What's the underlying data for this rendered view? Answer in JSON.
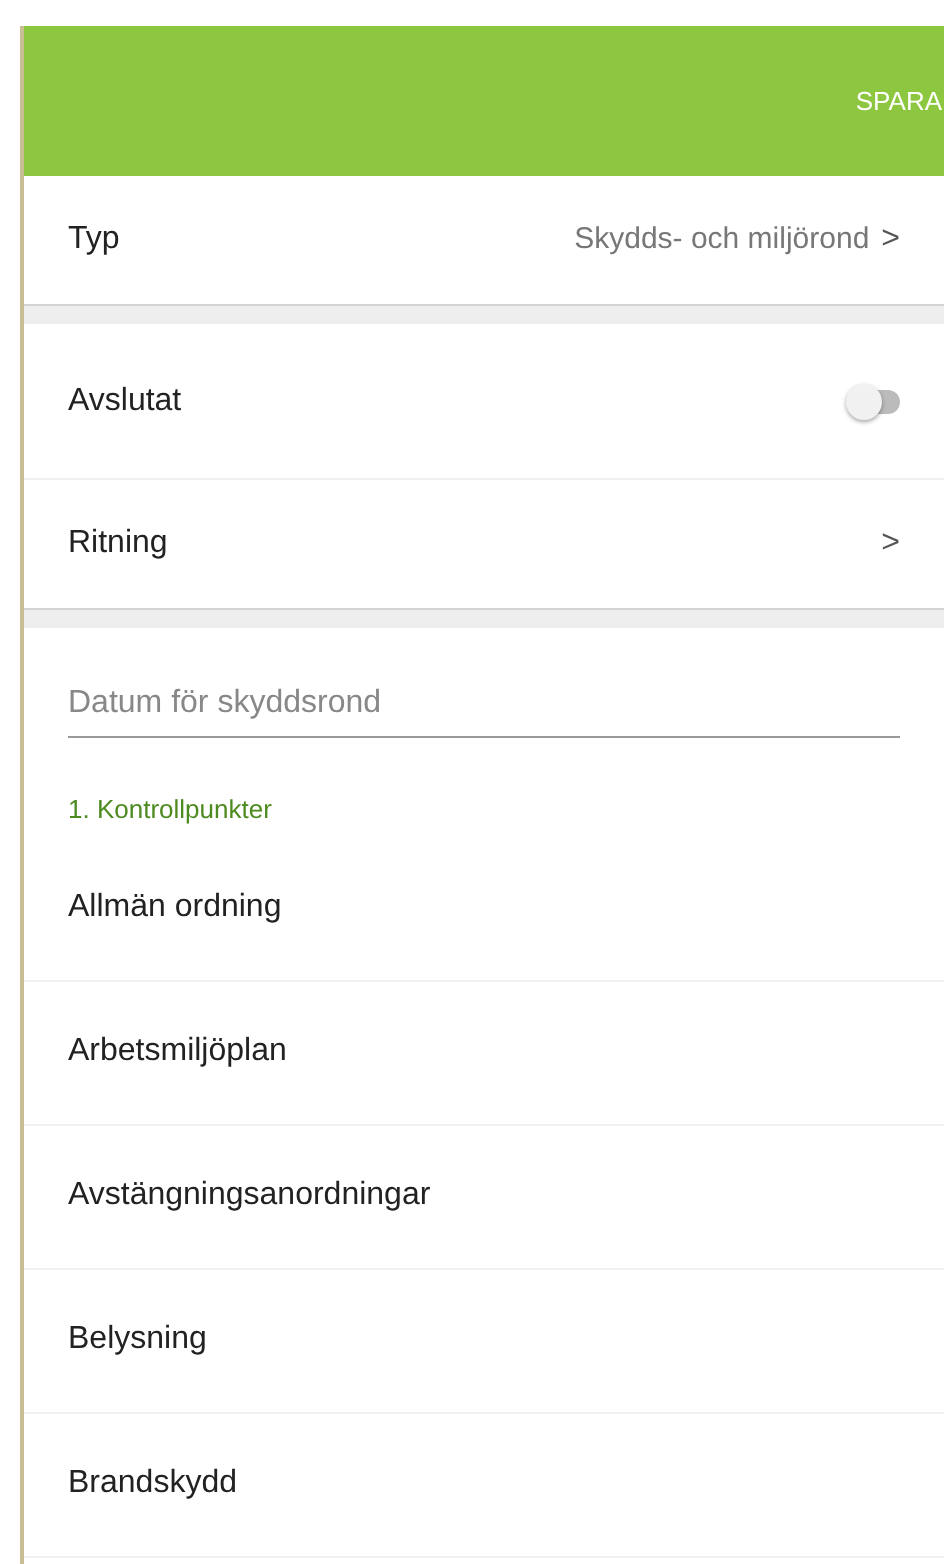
{
  "header": {
    "action": "SPARA"
  },
  "type_row": {
    "label": "Typ",
    "value": "Skydds- och miljörond",
    "chevron": ">"
  },
  "settings": [
    {
      "kind": "toggle",
      "label": "Avslutat",
      "on": false
    },
    {
      "kind": "link",
      "label": "Ritning",
      "chevron": ">"
    }
  ],
  "date_field": {
    "placeholder": "Datum för skyddsrond"
  },
  "section": {
    "title": "1. Kontrollpunkter",
    "items": [
      "Allmän ordning",
      "Arbetsmiljöplan",
      "Avstängningsanordningar",
      "Belysning",
      "Brandskydd"
    ]
  }
}
